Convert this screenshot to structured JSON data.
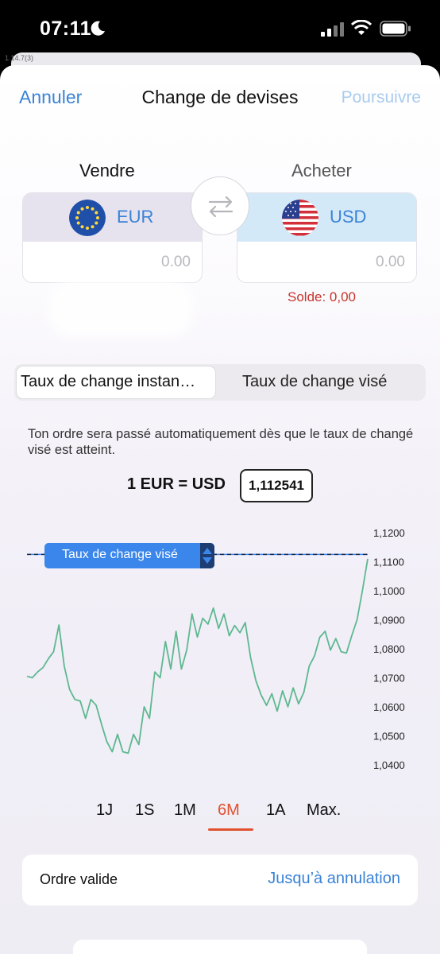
{
  "status_bar": {
    "time": "07:11"
  },
  "behind_label": "1.14.7(3)",
  "nav": {
    "cancel": "Annuler",
    "title": "Change de devises",
    "continue": "Poursuivre"
  },
  "sell": {
    "label": "Vendre",
    "currency": "EUR",
    "amount_placeholder": "0.00"
  },
  "buy": {
    "label": "Acheter",
    "currency": "USD",
    "amount_placeholder": "0.00",
    "balance": "Solde: 0,00"
  },
  "tabs": [
    {
      "label": "Taux de change instan…",
      "active": true
    },
    {
      "label": "Taux de change visé",
      "active": false
    }
  ],
  "info_text": "Ton ordre sera passé automatiquement dès que le taux de changé visé est atteint.",
  "rate": {
    "label": "1 EUR = USD",
    "value": "1,112541"
  },
  "target_marker_label": "Taux de change visé",
  "colors": {
    "accent": "#3a83d6",
    "line": "#5db88f",
    "period_active": "#e0512d",
    "balance": "#c8352b"
  },
  "chart_data": {
    "type": "line",
    "y_tick_labels": [
      "1,1200",
      "1,1100",
      "1,1000",
      "1,0900",
      "1,0800",
      "1,0700",
      "1,0600",
      "1,0500",
      "1,0400"
    ],
    "ylim": [
      1.04,
      1.12
    ],
    "target_rate": 1.1125,
    "series": [
      {
        "values": [
          1.0705,
          1.07,
          1.072,
          1.0735,
          1.0765,
          1.079,
          1.0882,
          1.074,
          1.066,
          1.0625,
          1.062,
          1.056,
          1.0625,
          1.0605,
          1.054,
          1.048,
          1.0445,
          1.0505,
          1.0445,
          1.044,
          1.0505,
          1.047,
          1.06,
          1.056,
          1.072,
          1.07,
          1.0825,
          1.073,
          1.086,
          1.073,
          1.0795,
          1.092,
          1.084,
          1.0905,
          1.0885,
          1.094,
          1.087,
          1.092,
          1.0845,
          1.088,
          1.0855,
          1.089,
          1.077,
          1.069,
          1.064,
          1.0605,
          1.0645,
          1.0585,
          1.0655,
          1.06,
          1.0665,
          1.061,
          1.065,
          1.074,
          1.0775,
          1.084,
          1.086,
          1.0795,
          1.0835,
          1.079,
          1.0785,
          1.0845,
          1.09,
          1.1,
          1.111
        ]
      }
    ]
  },
  "periods": [
    {
      "label": "1J",
      "active": false
    },
    {
      "label": "1S",
      "active": false
    },
    {
      "label": "1M",
      "active": false
    },
    {
      "label": "6M",
      "active": true
    },
    {
      "label": "1A",
      "active": false
    },
    {
      "label": "Max.",
      "active": false
    }
  ],
  "validity": {
    "label": "Ordre valide",
    "value": "Jusqu’à annulation"
  }
}
